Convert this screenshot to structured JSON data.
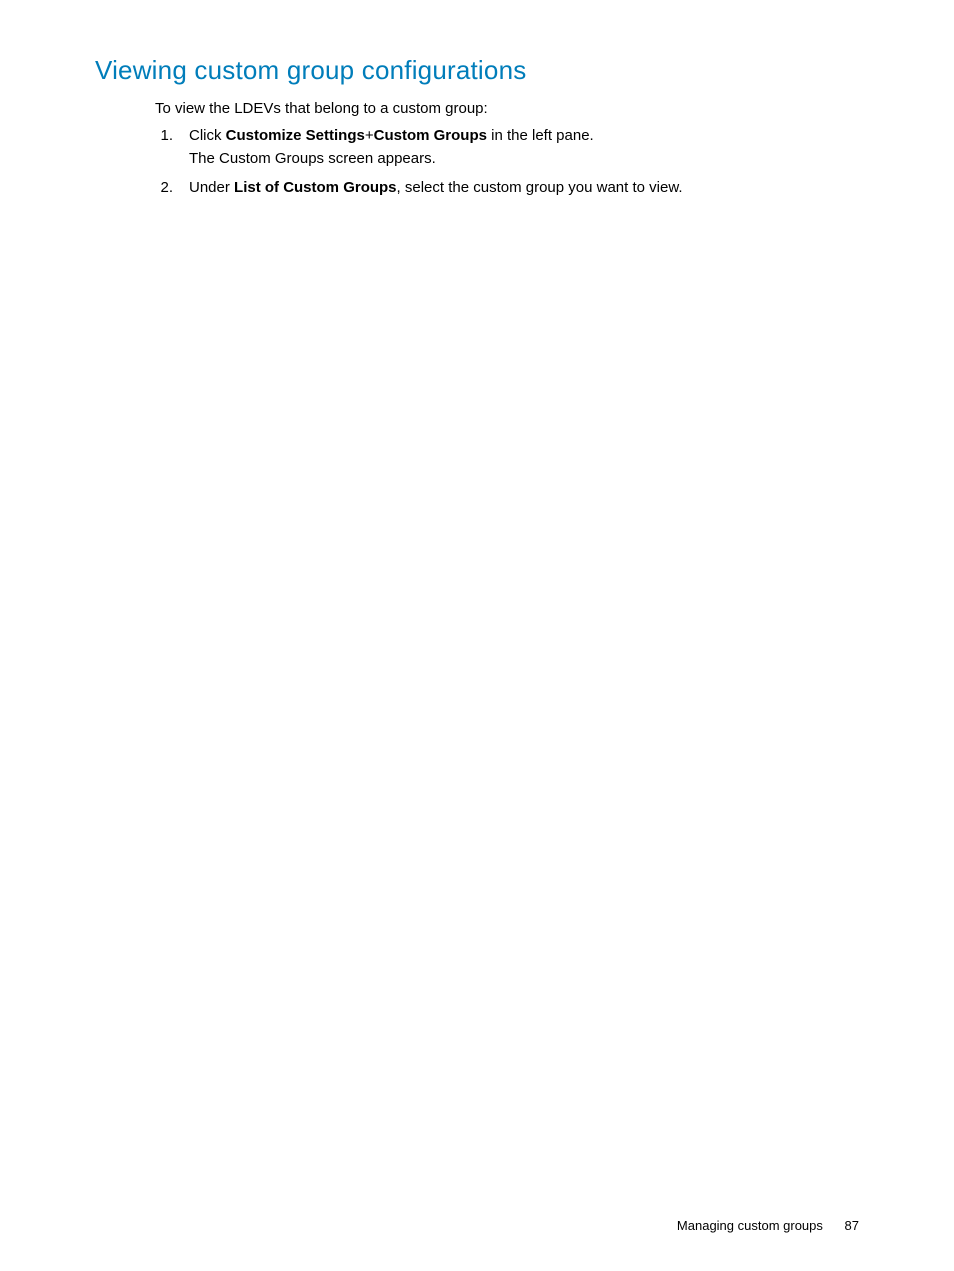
{
  "heading": "Viewing custom group configurations",
  "intro": "To view the LDEVs that belong to a custom group:",
  "steps": [
    {
      "number": "1.",
      "parts": [
        {
          "text": "Click ",
          "bold": false
        },
        {
          "text": "Customize Settings",
          "bold": true
        },
        {
          "text": "+",
          "bold": false
        },
        {
          "text": "Custom Groups",
          "bold": true
        },
        {
          "text": " in the left pane.",
          "bold": false
        }
      ],
      "followup": "The Custom Groups screen appears."
    },
    {
      "number": "2.",
      "parts": [
        {
          "text": "Under ",
          "bold": false
        },
        {
          "text": "List of Custom Groups",
          "bold": true
        },
        {
          "text": ", select the custom group you want to view.",
          "bold": false
        }
      ],
      "followup": null
    }
  ],
  "footer": {
    "section": "Managing custom groups",
    "page": "87"
  }
}
